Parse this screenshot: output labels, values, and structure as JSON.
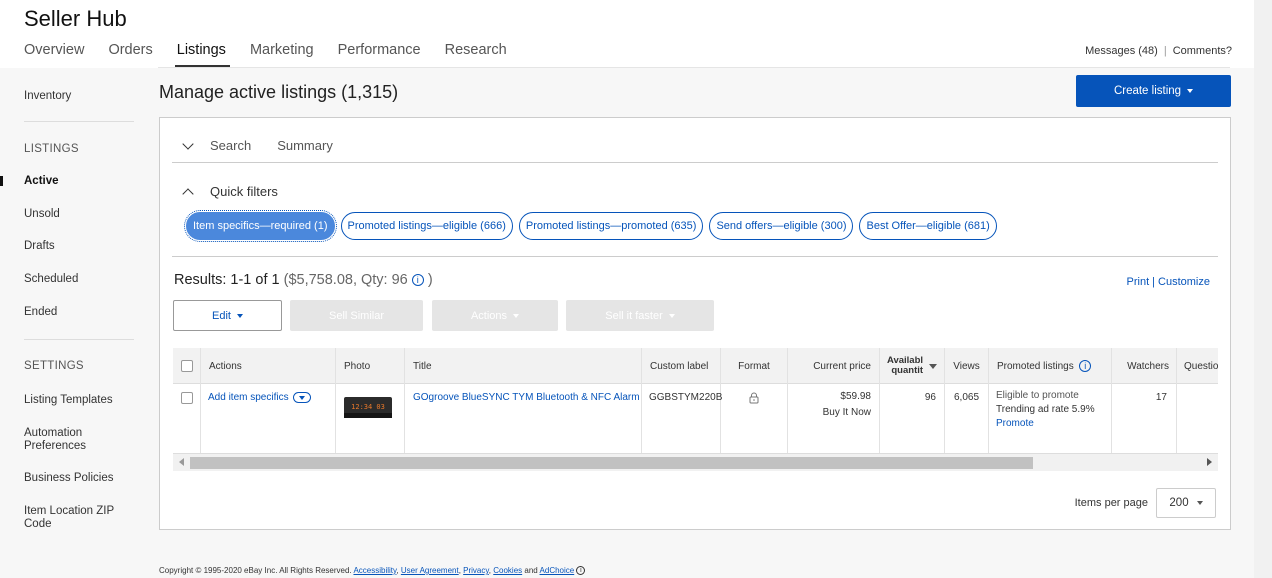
{
  "app": {
    "title": "Seller Hub"
  },
  "nav": {
    "tabs": [
      {
        "label": "Overview"
      },
      {
        "label": "Orders"
      },
      {
        "label": "Listings",
        "active": true
      },
      {
        "label": "Marketing"
      },
      {
        "label": "Performance"
      },
      {
        "label": "Research"
      }
    ],
    "messages": "Messages (48)",
    "comments": "Comments?"
  },
  "sidebar": {
    "inventory": "Inventory",
    "listings_heading": "LISTINGS",
    "listings": [
      "Active",
      "Unsold",
      "Drafts",
      "Scheduled",
      "Ended"
    ],
    "settings_heading": "SETTINGS",
    "settings": [
      "Listing Templates",
      "Automation Preferences",
      "Business Policies",
      "Item Location ZIP Code"
    ]
  },
  "main": {
    "title": "Manage active listings (1,315)",
    "create_button": "Create listing",
    "search_label": "Search",
    "summary_label": "Summary",
    "quick_filters_label": "Quick filters",
    "filters": [
      {
        "label": "Item specifics—required (1)",
        "active": true
      },
      {
        "label": "Promoted listings—eligible (666)"
      },
      {
        "label": "Promoted listings—promoted (635)"
      },
      {
        "label": "Send offers—eligible (300)"
      },
      {
        "label": "Best Offer—eligible (681)"
      }
    ],
    "results_label": "Results: 1-1 of 1",
    "results_detail": "($5,758.08, Qty: 96",
    "results_close": ")",
    "print_label": "Print",
    "customize_label": "Customize",
    "toolbar": {
      "edit": "Edit",
      "sell_similar": "Sell Similar",
      "actions": "Actions",
      "sell_it_faster": "Sell it faster"
    },
    "table": {
      "headers": {
        "actions": "Actions",
        "photo": "Photo",
        "title": "Title",
        "custom_label": "Custom label",
        "format": "Format",
        "current_price": "Current price",
        "available_qty_1": "Availabl",
        "available_qty_2": "quantit",
        "views": "Views",
        "promoted_listings": "Promoted listings",
        "watchers": "Watchers",
        "questions": "Questio"
      },
      "rows": [
        {
          "action": "Add item specifics",
          "title": "GOgroove BlueSYNC TYM Bluetooth & NFC Alarm",
          "custom_label": "GGBSTYM220B",
          "price": "$59.98",
          "price_format": "Buy It Now",
          "available": "96",
          "views": "6,065",
          "promo_status": "Eligible to promote",
          "promo_rate": "Trending ad rate 5.9%",
          "promo_link": "Promote",
          "watchers": "17",
          "clock_display": "12:34 03"
        }
      ]
    },
    "items_per_page_label": "Items per page",
    "items_per_page_value": "200"
  },
  "footer": {
    "copyright": "Copyright © 1995-2020 eBay Inc. All Rights Reserved.",
    "links": [
      "Accessibility",
      "User Agreement",
      "Privacy",
      "Cookies",
      "AdChoice"
    ],
    "and": "and"
  },
  "colors": {
    "accent": "#0654ba",
    "chip_active": "#4b88dc",
    "disabled": "#e5e5e5"
  }
}
